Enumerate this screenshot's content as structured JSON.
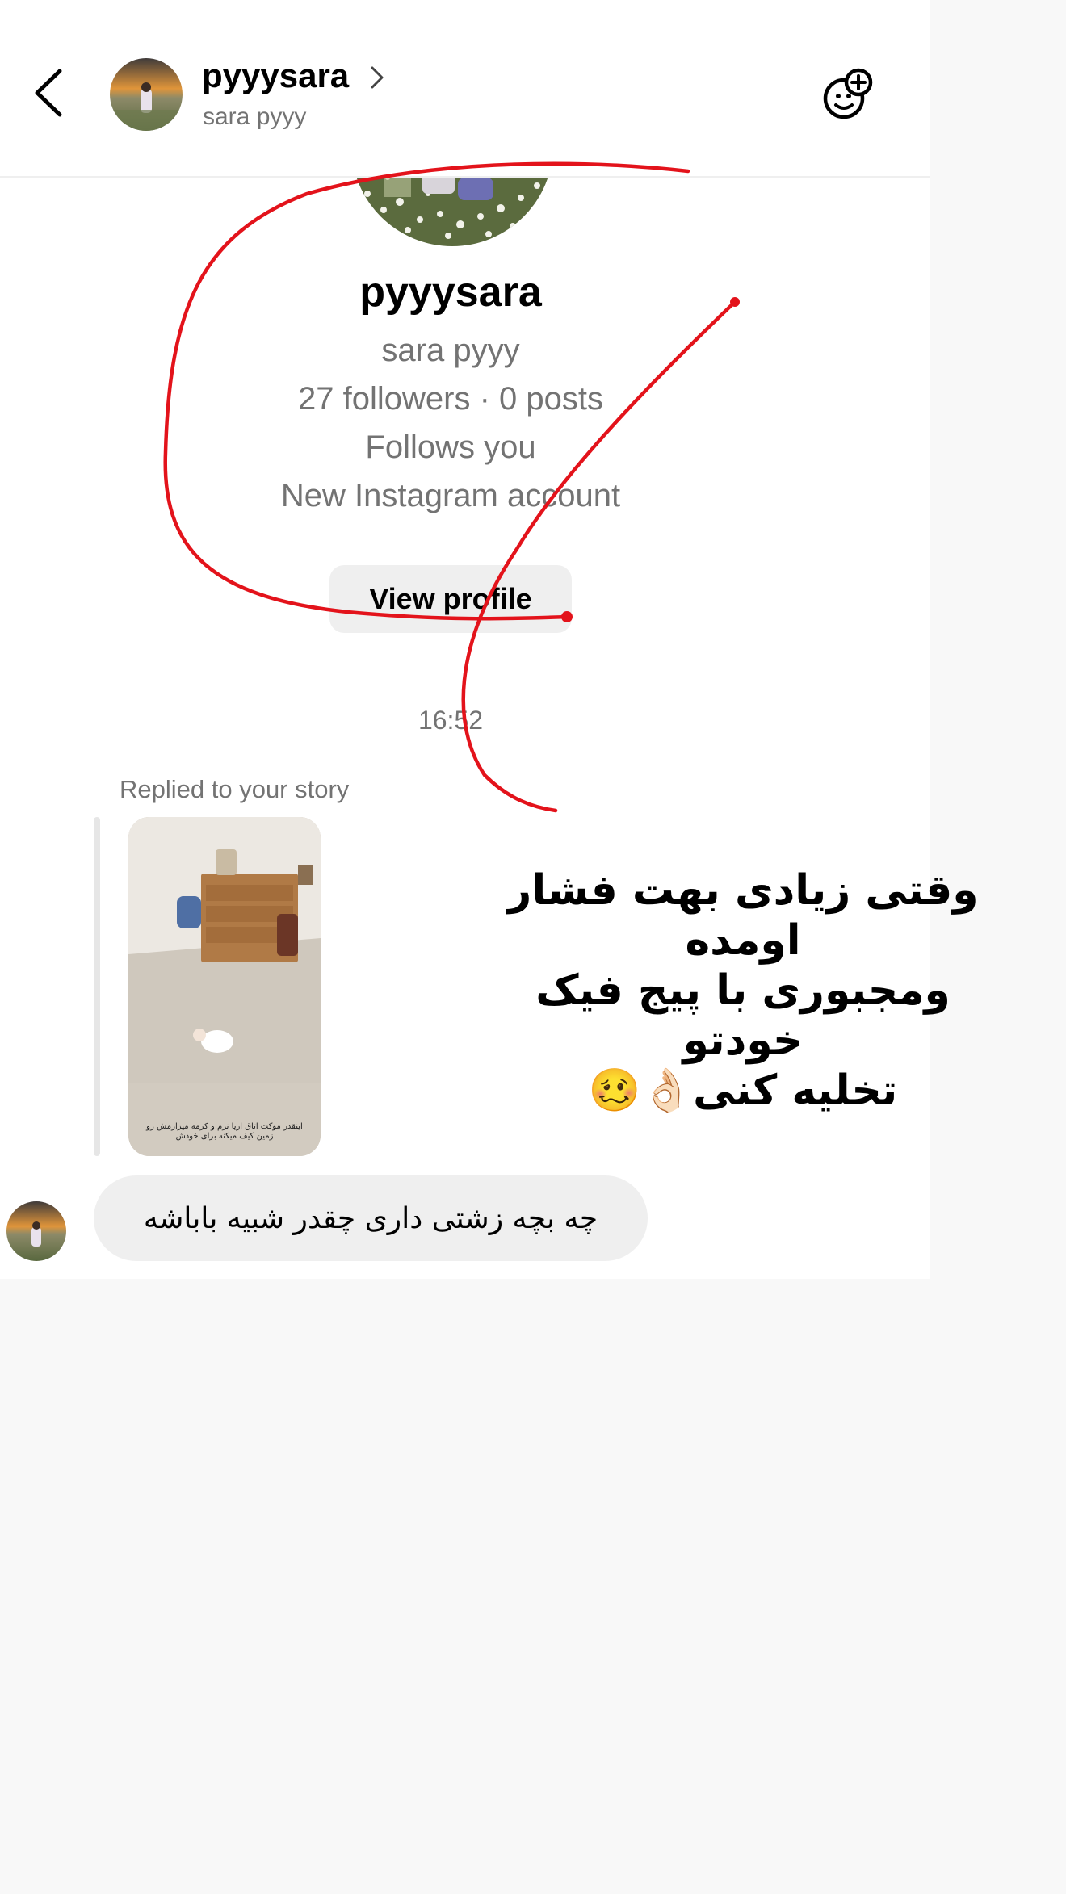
{
  "header": {
    "username": "pyyysara",
    "subname": "sara pyyy"
  },
  "profile": {
    "username": "pyyysara",
    "full_name": "sara pyyy",
    "stats": "27 followers · 0 posts",
    "follows_you": "Follows you",
    "new_account": "New Instagram account",
    "view_profile_label": "View profile"
  },
  "thread": {
    "timestamp": "16:52",
    "replied_label": "Replied to your story",
    "story_caption": "اینقدر موکت اتاق اریا نرم و کرمه میزارمش رو زمین کیف میکنه برای خودش",
    "message": "چه بچه زشتی داری چقدر شبیه باباشه"
  },
  "overlay": {
    "line1": "وقتی زیادی بهت فشار اومده",
    "line2": "ومجبوری با پیج فیک خودتو",
    "line3": "تخلیه کنی",
    "emoji": "👌🏻🥴"
  },
  "colors": {
    "scribble": "#e3131b",
    "secondary_text": "#737373",
    "bubble": "#efefef"
  },
  "icons": [
    "back-chevron-icon",
    "chevron-right-icon",
    "add-sticker-icon"
  ]
}
